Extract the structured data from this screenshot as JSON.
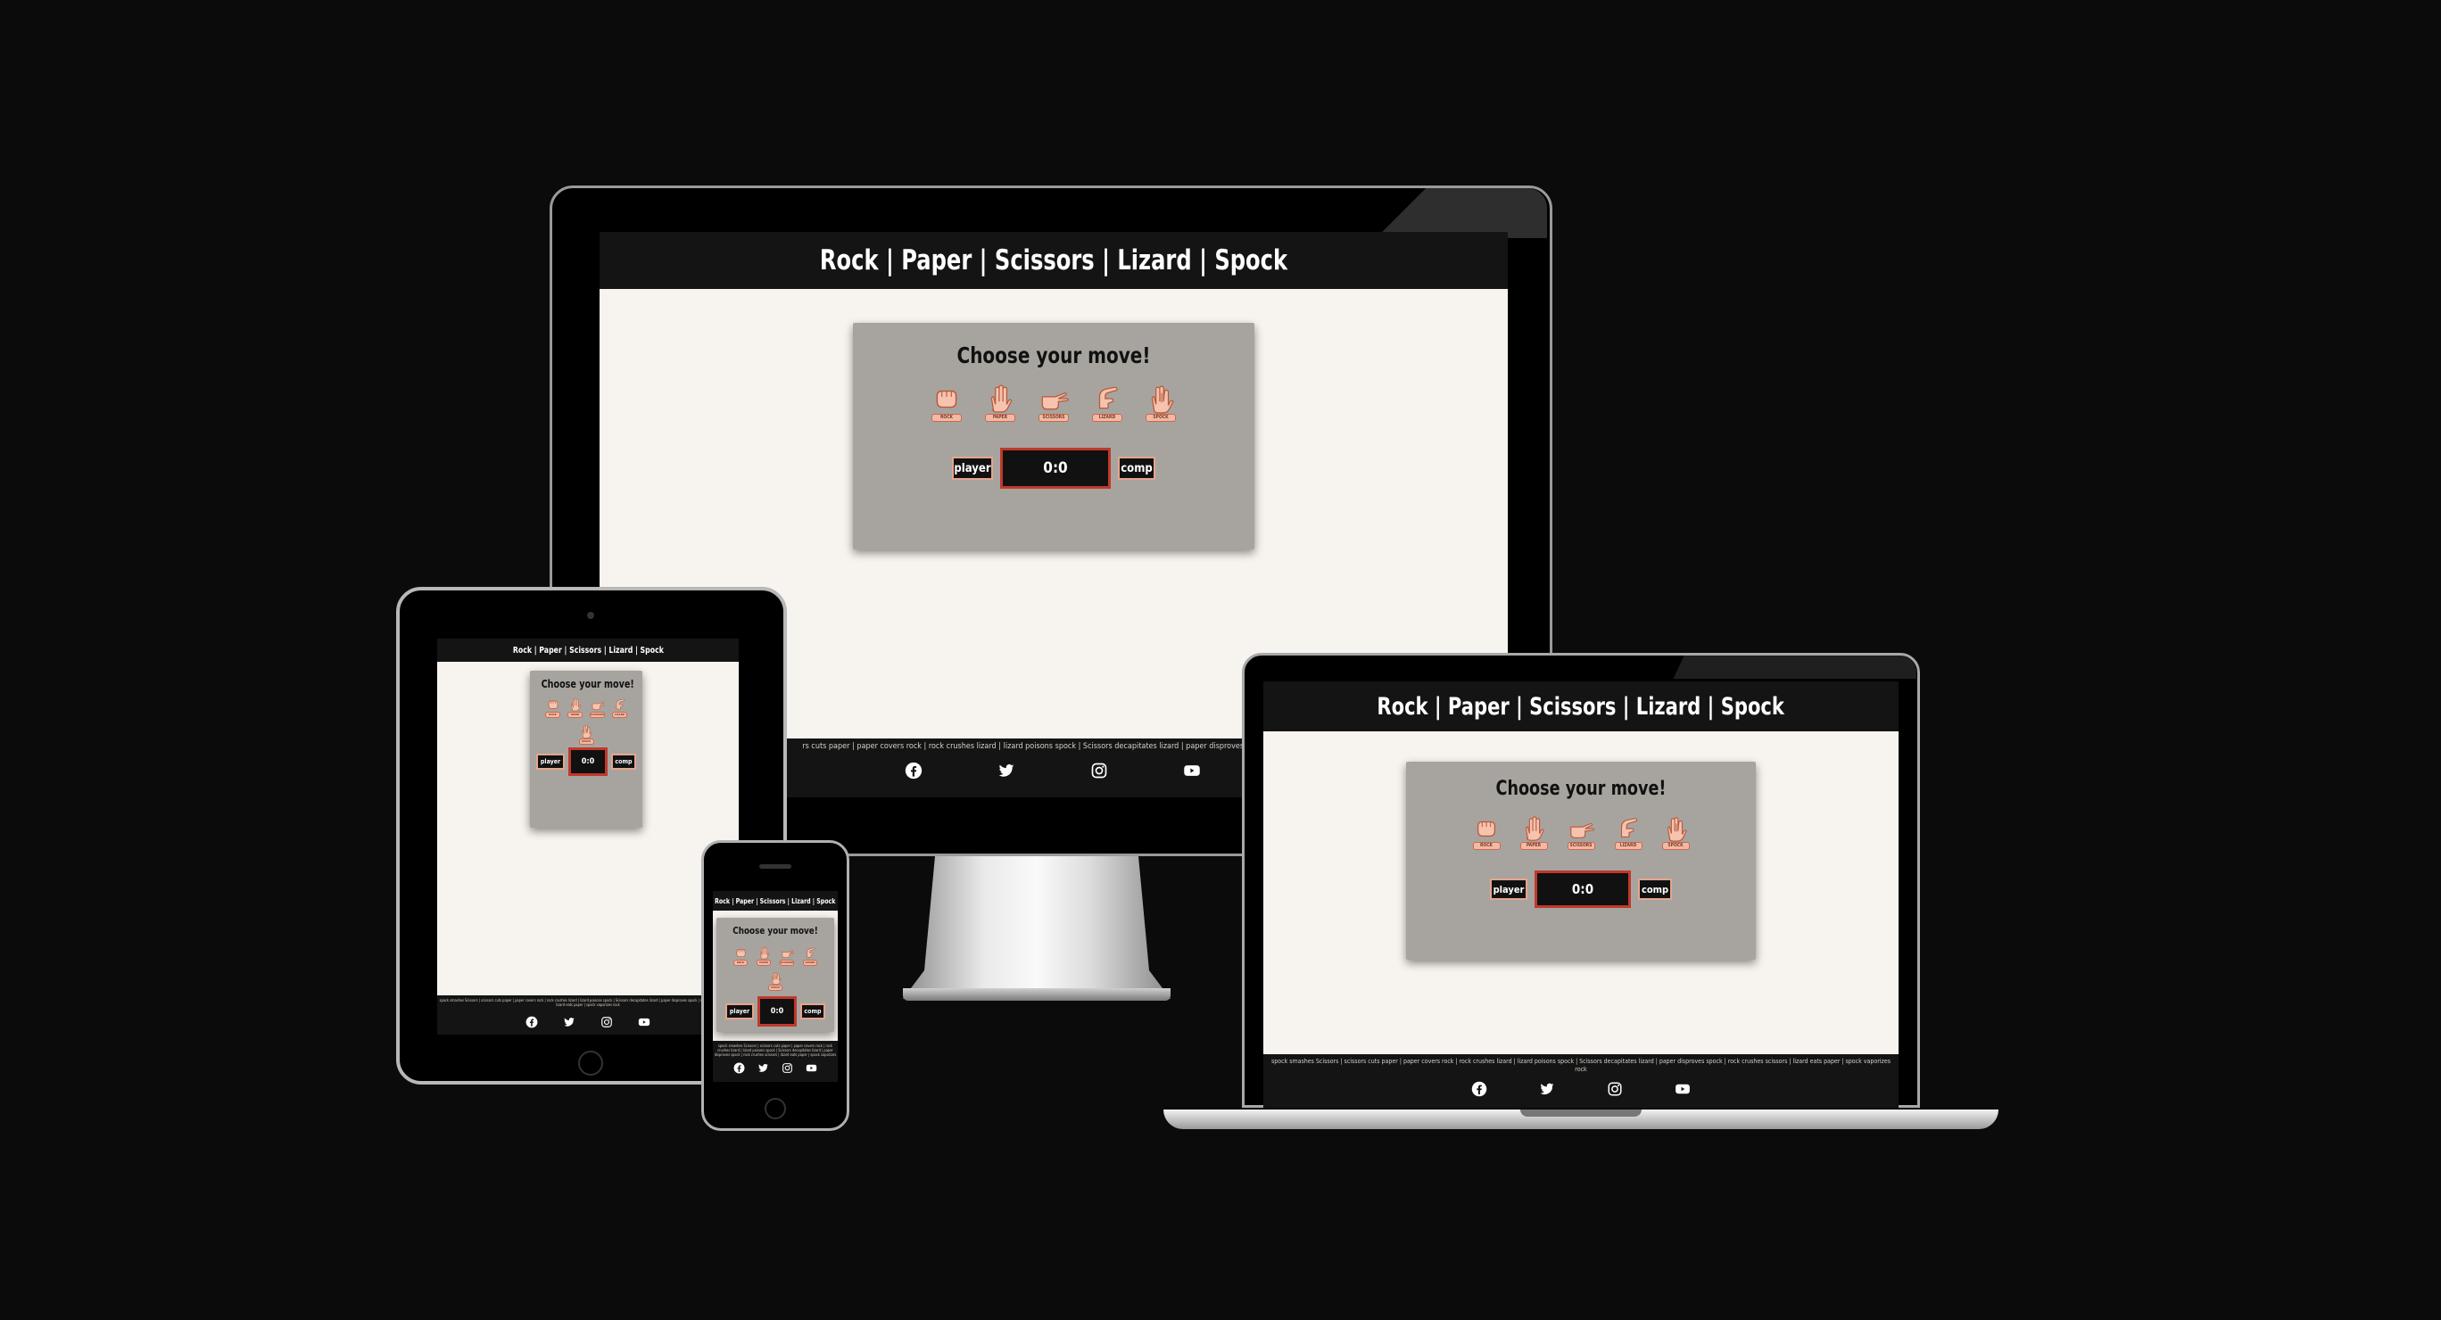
{
  "app": {
    "title": "Rock | Paper | Scissors | Lizard | Spock",
    "heading": "Choose your move!",
    "moves": [
      {
        "name": "rock",
        "tag": "rock"
      },
      {
        "name": "paper",
        "tag": "paper"
      },
      {
        "name": "scissors",
        "tag": "scissors"
      },
      {
        "name": "lizard",
        "tag": "lizard"
      },
      {
        "name": "spock",
        "tag": "spock"
      }
    ],
    "player_label": "player",
    "comp_label": "comp",
    "score": "0:0",
    "rules_monitor": "rs cuts paper | paper covers rock | rock crushes lizard | lizard poisons spock | Scissors decapitates lizard | paper disproves spock | rock cru",
    "rules_laptop": "spock smashes Scissors | scissors cuts paper | paper covers rock | rock crushes lizard | lizard poisons spock | Scissors decapitates lizard | paper disproves spock | rock crushes scissors | lizard eats paper | spock vaporizes rock",
    "rules_small": "spock smashes Scissors | scissors cuts paper | paper covers rock | rock crushes lizard | lizard poisons spock | Scissors decapitates lizard | paper disproves spock | rock crushes scissors | lizard eats paper | spock vaporizes rock",
    "socials": [
      "facebook",
      "twitter",
      "instagram",
      "youtube"
    ]
  },
  "colors": {
    "background": "#0c0b0b",
    "header": "#141414",
    "page": "#f7f3ee",
    "card": "#a7a49f",
    "accent": "#e6a48d",
    "score_border": "#c0392b"
  }
}
